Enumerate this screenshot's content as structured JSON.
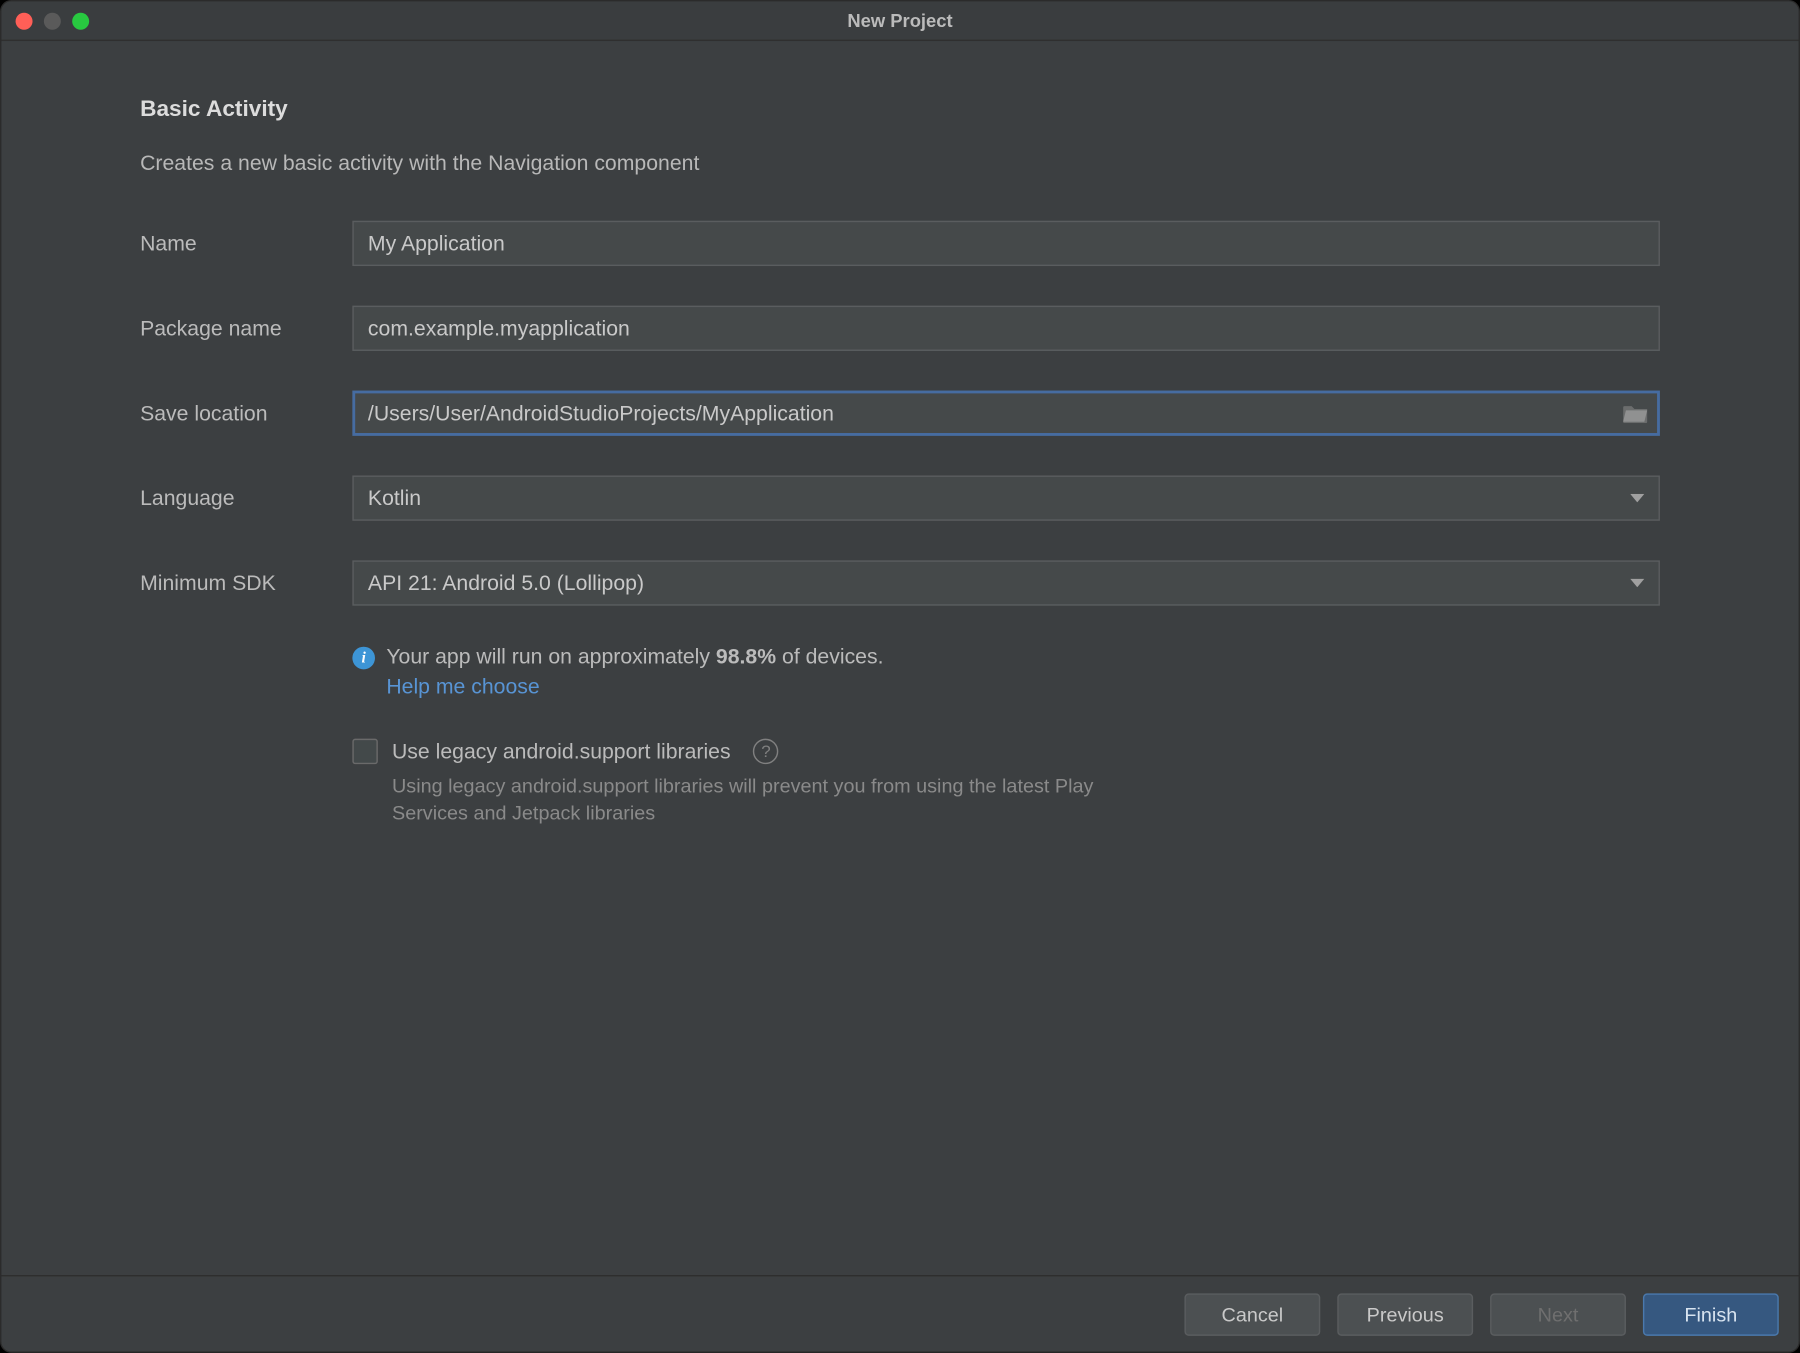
{
  "window": {
    "title": "New Project"
  },
  "heading": "Basic Activity",
  "subtitle": "Creates a new basic activity with the Navigation component",
  "labels": {
    "name": "Name",
    "package": "Package name",
    "location": "Save location",
    "language": "Language",
    "sdk": "Minimum SDK"
  },
  "fields": {
    "name": "My Application",
    "package": "com.example.myapplication",
    "location": "/Users/User/AndroidStudioProjects/MyApplication",
    "language": "Kotlin",
    "sdk": "API 21: Android 5.0 (Lollipop)"
  },
  "info": {
    "prefix": "Your app will run on approximately ",
    "percent": "98.8%",
    "suffix": " of devices.",
    "help_link": "Help me choose"
  },
  "legacy": {
    "label": "Use legacy android.support libraries",
    "desc": "Using legacy android.support libraries will prevent you from using the latest Play Services and Jetpack libraries"
  },
  "buttons": {
    "cancel": "Cancel",
    "previous": "Previous",
    "next": "Next",
    "finish": "Finish"
  }
}
